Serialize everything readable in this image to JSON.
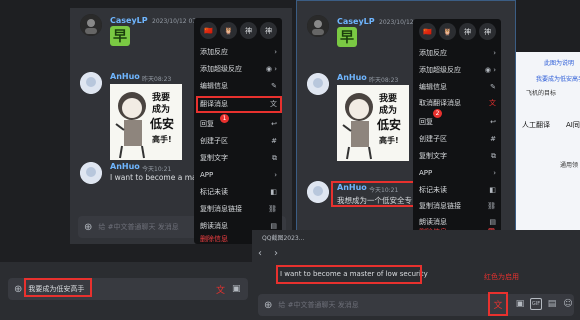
{
  "left": {
    "msg1": {
      "user": "CaseyLP",
      "time": "2023/10/12 07:29",
      "emoji": "早"
    },
    "msg2": {
      "user": "AnHuo",
      "time": "昨天08:23"
    },
    "msg3": {
      "user": "AnHuo",
      "time": "今天10:21",
      "text": "I want to become a master"
    },
    "input_placeholder": "给 #中文普通聊天 发消息",
    "bottom_text": "我要成为低安高手",
    "menu": {
      "react_emojis": [
        "🇨🇳",
        "🦉",
        "神",
        "神"
      ],
      "items": [
        {
          "label": "添加反应",
          "icon": "›"
        },
        {
          "label": "添加超级反应",
          "icon": "◉ ›"
        },
        {
          "label": "编辑信息",
          "icon": "✎"
        },
        {
          "label": "翻译消息",
          "icon": "文"
        },
        {
          "label": "回复",
          "icon": "↩"
        },
        {
          "label": "创建子区",
          "icon": "#"
        },
        {
          "label": "复制文字",
          "icon": "⧉"
        },
        {
          "label": "APP",
          "icon": "›"
        },
        {
          "label": "标记未读",
          "icon": "◧"
        },
        {
          "label": "复制消息链接",
          "icon": "⛓"
        },
        {
          "label": "朗读消息",
          "icon": "▤"
        },
        {
          "label": "删除信息",
          "icon": "🗑"
        }
      ],
      "badge": "1"
    }
  },
  "right": {
    "msg1": {
      "user": "CaseyLP",
      "time": "2023/10/12 07:29",
      "emoji": "早"
    },
    "msg2": {
      "user": "AnHuo",
      "time": "昨天08:23"
    },
    "msg3": {
      "user": "AnHuo",
      "time": "今天10:21",
      "text": "我想成为一个低安全专"
    },
    "menu": {
      "react_emojis": [
        "🇨🇳",
        "🦉",
        "神",
        "神"
      ],
      "items": [
        {
          "label": "添加反应",
          "icon": "›"
        },
        {
          "label": "添加超级反应",
          "icon": "◉ ›"
        },
        {
          "label": "编辑信息",
          "icon": "✎"
        },
        {
          "label": "取消翻译消息",
          "icon": "文"
        },
        {
          "label": "回复",
          "icon": "↩"
        },
        {
          "label": "创建子区",
          "icon": "#"
        },
        {
          "label": "复制文字",
          "icon": "⧉"
        },
        {
          "label": "APP",
          "icon": "›"
        },
        {
          "label": "标记未读",
          "icon": "◧"
        },
        {
          "label": "复制消息链接",
          "icon": "⛓"
        },
        {
          "label": "朗读消息",
          "icon": "▤"
        },
        {
          "label": "删除信息",
          "icon": "🗑"
        }
      ],
      "badge": "2"
    }
  },
  "sticker": {
    "line1": "我要",
    "line2": "成为",
    "line3": "低安",
    "line4": "高手!"
  },
  "qq": {
    "title": "QQ截图2023...",
    "translated": "I want to become a master of low security",
    "note": "红色为启用",
    "placeholder": "给 #中文普通聊天 发消息",
    "gif": "GIF"
  },
  "browser": {
    "title": "此图为说明",
    "q1": "我要成为低安高手&key",
    "q2": "飞机的目标",
    "tab": "人工翻译",
    "tab2": "AI同",
    "tab3": "通用领"
  }
}
